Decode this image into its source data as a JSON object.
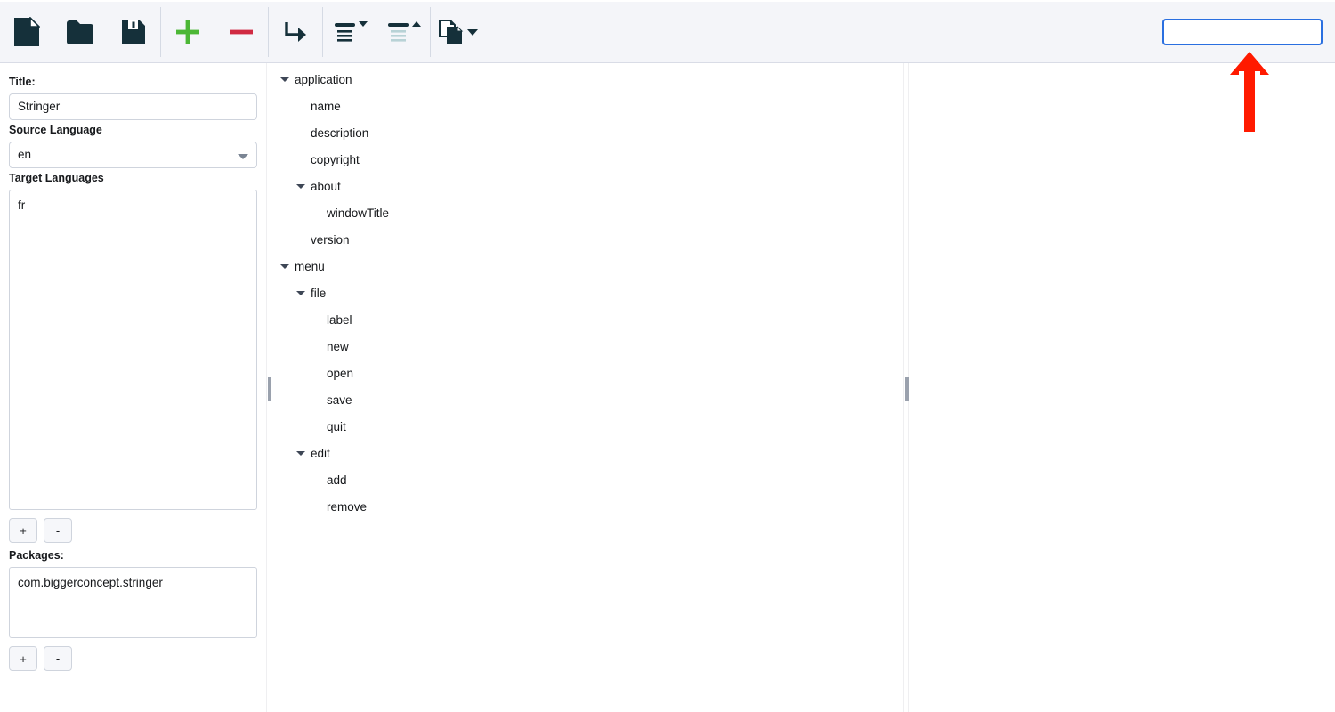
{
  "toolbar": {
    "buttons": [
      {
        "name": "new-file-button",
        "icon": "file-icon",
        "label": "New"
      },
      {
        "name": "open-folder-button",
        "icon": "folder-icon",
        "label": "Open"
      },
      {
        "name": "save-button",
        "icon": "floppy-disk-icon",
        "label": "Save"
      },
      {
        "name": "add-button",
        "icon": "plus-icon",
        "label": "Add"
      },
      {
        "name": "remove-button",
        "icon": "minus-icon",
        "label": "Remove"
      },
      {
        "name": "move-button",
        "icon": "arrow-turn-down-right-icon",
        "label": "Move"
      },
      {
        "name": "expand-all-button",
        "icon": "expand-all-icon",
        "label": "Expand All"
      },
      {
        "name": "collapse-all-button",
        "icon": "collapse-all-icon",
        "label": "Collapse All"
      },
      {
        "name": "duplicate-button",
        "icon": "copy-documents-icon",
        "label": "Duplicate"
      }
    ],
    "search": {
      "value": "",
      "placeholder": ""
    }
  },
  "left_panel": {
    "title": {
      "label": "Title:",
      "value": "Stringer"
    },
    "source_language": {
      "label": "Source Language",
      "value": "en",
      "options": [
        "en"
      ]
    },
    "target_languages": {
      "label": "Target Languages",
      "items": [
        "fr"
      ],
      "add_label": "+",
      "remove_label": "-"
    },
    "packages": {
      "label": "Packages:",
      "items": [
        "com.biggerconcept.stringer"
      ],
      "add_label": "+",
      "remove_label": "-"
    }
  },
  "tree": [
    {
      "label": "application",
      "depth": 0,
      "expandable": true,
      "expanded": true
    },
    {
      "label": "name",
      "depth": 1,
      "expandable": false,
      "expanded": false
    },
    {
      "label": "description",
      "depth": 1,
      "expandable": false,
      "expanded": false
    },
    {
      "label": "copyright",
      "depth": 1,
      "expandable": false,
      "expanded": false
    },
    {
      "label": "about",
      "depth": 1,
      "expandable": true,
      "expanded": true
    },
    {
      "label": "windowTitle",
      "depth": 2,
      "expandable": false,
      "expanded": false
    },
    {
      "label": "version",
      "depth": 1,
      "expandable": false,
      "expanded": false
    },
    {
      "label": "menu",
      "depth": 0,
      "expandable": true,
      "expanded": true
    },
    {
      "label": "file",
      "depth": 1,
      "expandable": true,
      "expanded": true
    },
    {
      "label": "label",
      "depth": 2,
      "expandable": false,
      "expanded": false
    },
    {
      "label": "new",
      "depth": 2,
      "expandable": false,
      "expanded": false
    },
    {
      "label": "open",
      "depth": 2,
      "expandable": false,
      "expanded": false
    },
    {
      "label": "save",
      "depth": 2,
      "expandable": false,
      "expanded": false
    },
    {
      "label": "quit",
      "depth": 2,
      "expandable": false,
      "expanded": false
    },
    {
      "label": "edit",
      "depth": 1,
      "expandable": true,
      "expanded": true
    },
    {
      "label": "add",
      "depth": 2,
      "expandable": false,
      "expanded": false
    },
    {
      "label": "remove",
      "depth": 2,
      "expandable": false,
      "expanded": false
    }
  ],
  "annotation": {
    "name": "red-arrow-pointing-to-search",
    "color": "#FF1A00",
    "points_to": "search-input"
  },
  "colors": {
    "toolbar_bg": "#f4f5f9",
    "icon_dark": "#15303a",
    "add_green": "#4cb736",
    "remove_red": "#d02a42",
    "focus_blue": "#2a6fe0",
    "splitter_grip": "#9aa1ad",
    "annotation_red": "#FF1A00"
  }
}
